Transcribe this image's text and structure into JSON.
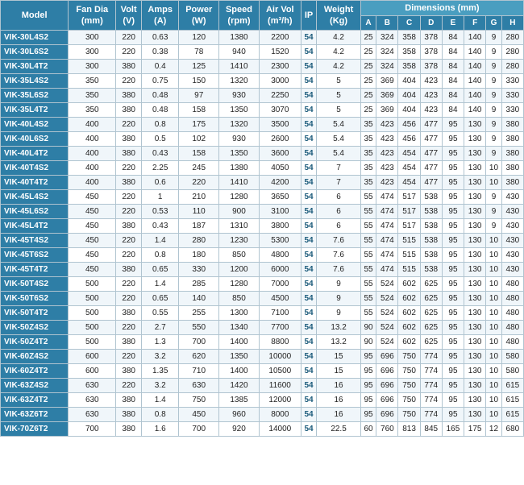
{
  "table": {
    "headers": {
      "top": [
        "Model",
        "Fan Dia (mm)",
        "Volt (V)",
        "Amps (A)",
        "Power (W)",
        "Speed (rpm)",
        "Air Vol (m³/h)",
        "IP",
        "Weight (Kg)",
        "Dimensions (mm)"
      ],
      "dim_sub": [
        "A",
        "B",
        "C",
        "D",
        "E",
        "F",
        "G",
        "H"
      ]
    },
    "rows": [
      [
        "VIK-30L4S2",
        "300",
        "220",
        "0.63",
        "120",
        "1380",
        "2200",
        "54",
        "4.2",
        "25",
        "324",
        "358",
        "378",
        "84",
        "140",
        "9",
        "280"
      ],
      [
        "VIK-30L6S2",
        "300",
        "220",
        "0.38",
        "78",
        "940",
        "1520",
        "54",
        "4.2",
        "25",
        "324",
        "358",
        "378",
        "84",
        "140",
        "9",
        "280"
      ],
      [
        "VIK-30L4T2",
        "300",
        "380",
        "0.4",
        "125",
        "1410",
        "2300",
        "54",
        "4.2",
        "25",
        "324",
        "358",
        "378",
        "84",
        "140",
        "9",
        "280"
      ],
      [
        "VIK-35L4S2",
        "350",
        "220",
        "0.75",
        "150",
        "1320",
        "3000",
        "54",
        "5",
        "25",
        "369",
        "404",
        "423",
        "84",
        "140",
        "9",
        "330"
      ],
      [
        "VIK-35L6S2",
        "350",
        "380",
        "0.48",
        "97",
        "930",
        "2250",
        "54",
        "5",
        "25",
        "369",
        "404",
        "423",
        "84",
        "140",
        "9",
        "330"
      ],
      [
        "VIK-35L4T2",
        "350",
        "380",
        "0.48",
        "158",
        "1350",
        "3070",
        "54",
        "5",
        "25",
        "369",
        "404",
        "423",
        "84",
        "140",
        "9",
        "330"
      ],
      [
        "VIK-40L4S2",
        "400",
        "220",
        "0.8",
        "175",
        "1320",
        "3500",
        "54",
        "5.4",
        "35",
        "423",
        "456",
        "477",
        "95",
        "130",
        "9",
        "380"
      ],
      [
        "VIK-40L6S2",
        "400",
        "380",
        "0.5",
        "102",
        "930",
        "2600",
        "54",
        "5.4",
        "35",
        "423",
        "456",
        "477",
        "95",
        "130",
        "9",
        "380"
      ],
      [
        "VIK-40L4T2",
        "400",
        "380",
        "0.43",
        "158",
        "1350",
        "3600",
        "54",
        "5.4",
        "35",
        "423",
        "454",
        "477",
        "95",
        "130",
        "9",
        "380"
      ],
      [
        "VIK-40T4S2",
        "400",
        "220",
        "2.25",
        "245",
        "1380",
        "4050",
        "54",
        "7",
        "35",
        "423",
        "454",
        "477",
        "95",
        "130",
        "10",
        "380"
      ],
      [
        "VIK-40T4T2",
        "400",
        "380",
        "0.6",
        "220",
        "1410",
        "4200",
        "54",
        "7",
        "35",
        "423",
        "454",
        "477",
        "95",
        "130",
        "10",
        "380"
      ],
      [
        "VIK-45L4S2",
        "450",
        "220",
        "1",
        "210",
        "1280",
        "3650",
        "54",
        "6",
        "55",
        "474",
        "517",
        "538",
        "95",
        "130",
        "9",
        "430"
      ],
      [
        "VIK-45L6S2",
        "450",
        "220",
        "0.53",
        "110",
        "900",
        "3100",
        "54",
        "6",
        "55",
        "474",
        "517",
        "538",
        "95",
        "130",
        "9",
        "430"
      ],
      [
        "VIK-45L4T2",
        "450",
        "380",
        "0.43",
        "187",
        "1310",
        "3800",
        "54",
        "6",
        "55",
        "474",
        "517",
        "538",
        "95",
        "130",
        "9",
        "430"
      ],
      [
        "VIK-45T4S2",
        "450",
        "220",
        "1.4",
        "280",
        "1230",
        "5300",
        "54",
        "7.6",
        "55",
        "474",
        "515",
        "538",
        "95",
        "130",
        "10",
        "430"
      ],
      [
        "VIK-45T6S2",
        "450",
        "220",
        "0.8",
        "180",
        "850",
        "4800",
        "54",
        "7.6",
        "55",
        "474",
        "515",
        "538",
        "95",
        "130",
        "10",
        "430"
      ],
      [
        "VIK-45T4T2",
        "450",
        "380",
        "0.65",
        "330",
        "1200",
        "6000",
        "54",
        "7.6",
        "55",
        "474",
        "515",
        "538",
        "95",
        "130",
        "10",
        "430"
      ],
      [
        "VIK-50T4S2",
        "500",
        "220",
        "1.4",
        "285",
        "1280",
        "7000",
        "54",
        "9",
        "55",
        "524",
        "602",
        "625",
        "95",
        "130",
        "10",
        "480"
      ],
      [
        "VIK-50T6S2",
        "500",
        "220",
        "0.65",
        "140",
        "850",
        "4500",
        "54",
        "9",
        "55",
        "524",
        "602",
        "625",
        "95",
        "130",
        "10",
        "480"
      ],
      [
        "VIK-50T4T2",
        "500",
        "380",
        "0.55",
        "255",
        "1300",
        "7100",
        "54",
        "9",
        "55",
        "524",
        "602",
        "625",
        "95",
        "130",
        "10",
        "480"
      ],
      [
        "VIK-50Z4S2",
        "500",
        "220",
        "2.7",
        "550",
        "1340",
        "7700",
        "54",
        "13.2",
        "90",
        "524",
        "602",
        "625",
        "95",
        "130",
        "10",
        "480"
      ],
      [
        "VIK-50Z4T2",
        "500",
        "380",
        "1.3",
        "700",
        "1400",
        "8800",
        "54",
        "13.2",
        "90",
        "524",
        "602",
        "625",
        "95",
        "130",
        "10",
        "480"
      ],
      [
        "VIK-60Z4S2",
        "600",
        "220",
        "3.2",
        "620",
        "1350",
        "10000",
        "54",
        "15",
        "95",
        "696",
        "750",
        "774",
        "95",
        "130",
        "10",
        "580"
      ],
      [
        "VIK-60Z4T2",
        "600",
        "380",
        "1.35",
        "710",
        "1400",
        "10500",
        "54",
        "15",
        "95",
        "696",
        "750",
        "774",
        "95",
        "130",
        "10",
        "580"
      ],
      [
        "VIK-63Z4S2",
        "630",
        "220",
        "3.2",
        "630",
        "1420",
        "11600",
        "54",
        "16",
        "95",
        "696",
        "750",
        "774",
        "95",
        "130",
        "10",
        "615"
      ],
      [
        "VIK-63Z4T2",
        "630",
        "380",
        "1.4",
        "750",
        "1385",
        "12000",
        "54",
        "16",
        "95",
        "696",
        "750",
        "774",
        "95",
        "130",
        "10",
        "615"
      ],
      [
        "VIK-63Z6T2",
        "630",
        "380",
        "0.8",
        "450",
        "960",
        "8000",
        "54",
        "16",
        "95",
        "696",
        "750",
        "774",
        "95",
        "130",
        "10",
        "615"
      ],
      [
        "VIK-70Z6T2",
        "700",
        "380",
        "1.6",
        "700",
        "920",
        "14000",
        "54",
        "22.5",
        "60",
        "760",
        "813",
        "845",
        "165",
        "175",
        "12",
        "680"
      ]
    ]
  }
}
